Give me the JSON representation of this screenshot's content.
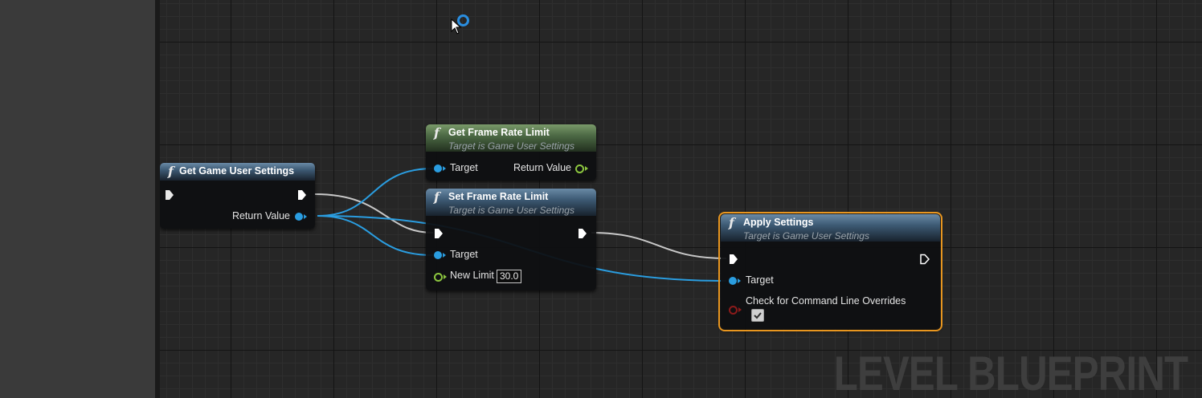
{
  "watermark": "LEVEL BLUEPRINT",
  "nodes": {
    "get_game_user_settings": {
      "title": "Get Game User Settings",
      "return_label": "Return Value"
    },
    "get_frame_rate_limit": {
      "title": "Get Frame Rate Limit",
      "subtitle": "Target is Game User Settings",
      "target_label": "Target",
      "return_label": "Return Value"
    },
    "set_frame_rate_limit": {
      "title": "Set Frame Rate Limit",
      "subtitle": "Target is Game User Settings",
      "target_label": "Target",
      "new_limit_label": "New Limit",
      "new_limit_value": "30.0"
    },
    "apply_settings": {
      "title": "Apply Settings",
      "subtitle": "Target is Game User Settings",
      "target_label": "Target",
      "override_label": "Check for Command Line Overrides",
      "override_checked": true
    }
  },
  "colors": {
    "object_pin": "#2a9de0",
    "float_pin": "#8cc63f",
    "bool_pin": "#8c1b1b",
    "exec_wire": "#c8c8c8",
    "selection": "#e8961f"
  }
}
